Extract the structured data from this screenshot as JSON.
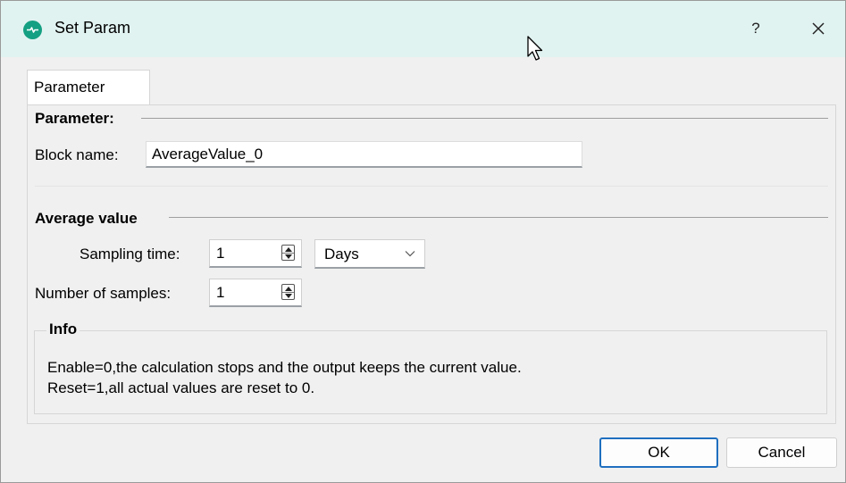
{
  "window": {
    "title": "Set Param",
    "help_label": "?",
    "close_icon": "close-icon",
    "app_icon": "app-logo-icon",
    "accent_color": "#14a082",
    "titlebar_color": "#e1f3f1"
  },
  "tabs": [
    {
      "label": "Parameter",
      "selected": true
    }
  ],
  "parameter_group": {
    "title": "Parameter:",
    "block_name_label": "Block name:",
    "block_name_value": "AverageValue_0"
  },
  "average_group": {
    "title": "Average value",
    "sampling_time_label": "Sampling time:",
    "sampling_time_value": "1",
    "sampling_unit_value": "Days",
    "samples_label": "Number of samples:",
    "samples_value": "1"
  },
  "info": {
    "title": "Info",
    "line1": "Enable=0,the calculation stops and the output keeps the current value.",
    "line2": "Reset=1,all actual values are reset to 0."
  },
  "buttons": {
    "ok": "OK",
    "cancel": "Cancel",
    "focus_color": "#1f6fbf"
  }
}
